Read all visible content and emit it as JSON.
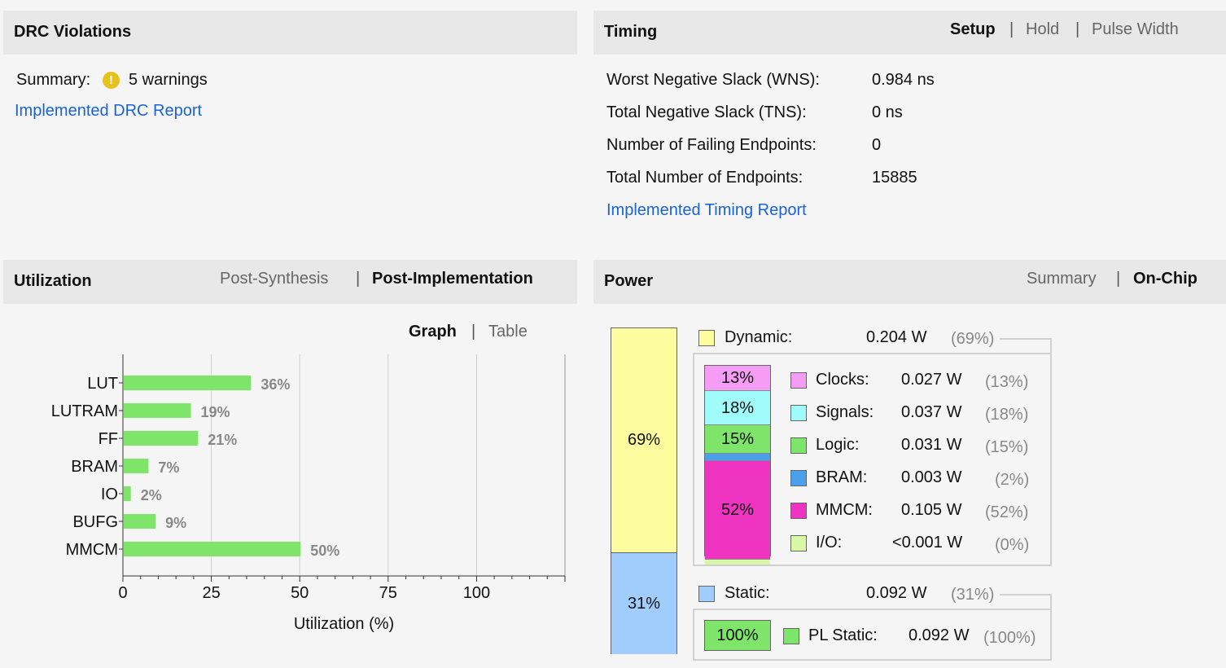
{
  "drc": {
    "title": "DRC Violations",
    "summary_label": "Summary:",
    "warning_icon": "!",
    "warnings": "5 warnings",
    "report_link": "Implemented DRC Report"
  },
  "timing": {
    "title": "Timing",
    "tabs": [
      "Setup",
      "Hold",
      "Pulse Width"
    ],
    "active_tab": "Setup",
    "rows": [
      {
        "label": "Worst Negative Slack (WNS):",
        "value": "0.984 ns"
      },
      {
        "label": "Total Negative Slack (TNS):",
        "value": "0 ns"
      },
      {
        "label": "Number of Failing Endpoints:",
        "value": "0"
      },
      {
        "label": "Total Number of Endpoints:",
        "value": "15885"
      }
    ],
    "report_link": "Implemented Timing Report"
  },
  "utilization": {
    "title": "Utilization",
    "tabs": [
      "Post-Synthesis",
      "Post-Implementation"
    ],
    "active_tab": "Post-Implementation",
    "view_tabs": [
      "Graph",
      "Table"
    ],
    "active_view": "Graph"
  },
  "chart_data": {
    "type": "bar",
    "orientation": "horizontal",
    "categories": [
      "LUT",
      "LUTRAM",
      "FF",
      "BRAM",
      "IO",
      "BUFG",
      "MMCM"
    ],
    "values": [
      36,
      19,
      21,
      7,
      2,
      9,
      50
    ],
    "value_labels": [
      "36%",
      "19%",
      "21%",
      "7%",
      "2%",
      "9%",
      "50%"
    ],
    "xticks": [
      0,
      25,
      50,
      75,
      100
    ],
    "xlim": [
      0,
      125
    ],
    "xlabel": "Utilization (%)",
    "bar_color": "#7ee46a",
    "grid": true
  },
  "power": {
    "title": "Power",
    "tabs": [
      "Summary",
      "On-Chip"
    ],
    "active_tab": "On-Chip",
    "total_bar": [
      {
        "label": "69%",
        "fraction": 0.69,
        "color": "#fdfda0"
      },
      {
        "label": "31%",
        "fraction": 0.31,
        "color": "#a0cdfb"
      }
    ],
    "dynamic": {
      "label": "Dynamic:",
      "value": "0.204 W",
      "pct": "(69%)",
      "color": "#fdfda0"
    },
    "dynamic_items": [
      {
        "label": "Clocks:",
        "value": "0.027 W",
        "pct": "(13%)",
        "bar_text": "13%",
        "fraction": 0.13,
        "color": "#f59cf5"
      },
      {
        "label": "Signals:",
        "value": "0.037 W",
        "pct": "(18%)",
        "bar_text": "18%",
        "fraction": 0.18,
        "color": "#a0fbfb"
      },
      {
        "label": "Logic:",
        "value": "0.031 W",
        "pct": "(15%)",
        "bar_text": "15%",
        "fraction": 0.15,
        "color": "#7ee46a"
      },
      {
        "label": "BRAM:",
        "value": "0.003 W",
        "pct": "(2%)",
        "bar_text": "",
        "fraction": 0.02,
        "color": "#4aa0ec"
      },
      {
        "label": "MMCM:",
        "value": "0.105 W",
        "pct": "(52%)",
        "bar_text": "52%",
        "fraction": 0.52,
        "color": "#ee34c0"
      },
      {
        "label": "I/O:",
        "value": "<0.001 W",
        "pct": "(0%)",
        "bar_text": "",
        "fraction": 0.0,
        "color": "#d8f8a8"
      }
    ],
    "static": {
      "label": "Static:",
      "value": "0.092 W",
      "pct": "(31%)",
      "color": "#a0cdfb"
    },
    "static_items": [
      {
        "label": "PL Static:",
        "value": "0.092 W",
        "pct": "(100%)",
        "bar_text": "100%",
        "color": "#7ee46a"
      }
    ]
  }
}
